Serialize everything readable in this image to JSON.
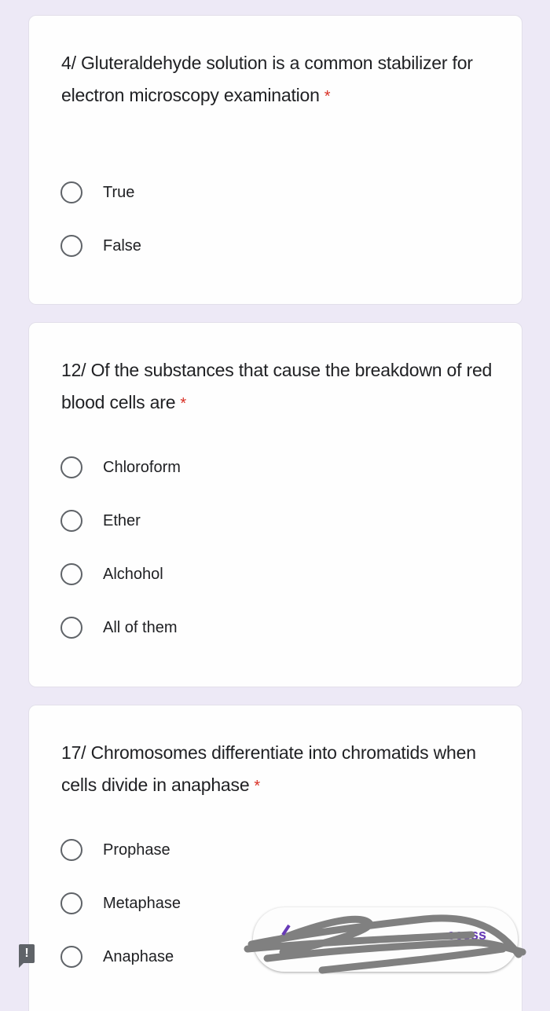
{
  "form": {
    "required_marker": "*",
    "questions": [
      {
        "text": "4/ Gluteraldehyde solution is a common stabilizer for electron microscopy examination",
        "required": true,
        "options": [
          "True",
          "False"
        ]
      },
      {
        "text": "12/ Of the substances that cause the breakdown of red blood cells are",
        "required": true,
        "options": [
          "Chloroform",
          "Ether",
          "Alchohol",
          "All of them"
        ]
      },
      {
        "text": "17/ Chromosomes differentiate into chromatids when cells divide in anaphase",
        "required": true,
        "options": [
          "Prophase",
          "Metaphase",
          "Anaphase"
        ]
      }
    ]
  },
  "report_button": {
    "icon": "!"
  },
  "snackbar": {
    "text": "...ccess",
    "obscured": true,
    "accent_color": "#673ab7"
  },
  "colors": {
    "background": "#ede9f6",
    "required": "#d93025",
    "radio": "#5f6368"
  }
}
